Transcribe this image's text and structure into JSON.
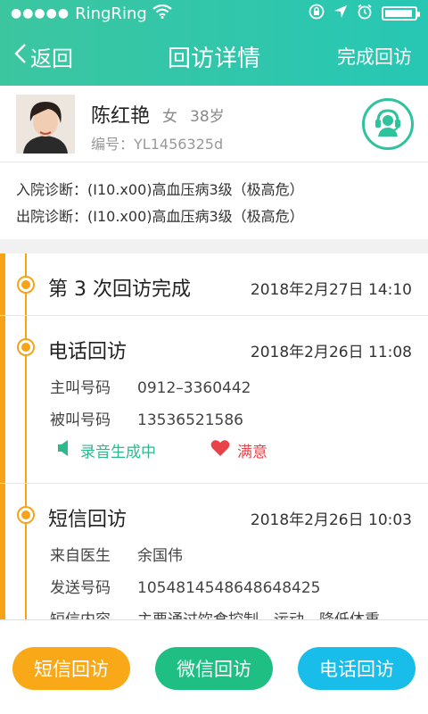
{
  "status_bar": {
    "carrier": "RingRing",
    "signal_dots": "●●●●●"
  },
  "nav": {
    "back_label": "返回",
    "title": "回访详情",
    "action_label": "完成回访"
  },
  "patient": {
    "name": "陈红艳",
    "gender": "女",
    "age": "38岁",
    "id_label": "编号：",
    "id_value": "YL1456325d"
  },
  "diagnosis": {
    "admission_label": "入院诊断：",
    "admission_value": "(I10.x00)高血压病3级（极高危）",
    "discharge_label": "出院诊断：",
    "discharge_value": "(I10.x00)高血压病3级（极高危）"
  },
  "timeline": [
    {
      "title": "第 3 次回访完成",
      "time": "2018年2月27日 14:10"
    },
    {
      "title": "电话回访",
      "time": "2018年2月26日 11:08",
      "fields": [
        {
          "label": "主叫号码",
          "value": "0912–3360442"
        },
        {
          "label": "被叫号码",
          "value": "13536521586"
        }
      ],
      "recording_status": "录音生成中",
      "satisfaction": "满意"
    },
    {
      "title": "短信回访",
      "time": "2018年2月26日 10:03",
      "fields": [
        {
          "label": "来自医生",
          "value": "余国伟"
        },
        {
          "label": "发送号码",
          "value": "1054814548648648425"
        },
        {
          "label": "短信内容",
          "value": "主要通过饮食控制、运动、降低体重"
        }
      ]
    }
  ],
  "actions": {
    "sms_label": "短信回访",
    "wechat_label": "微信回访",
    "phone_label": "电话回访"
  },
  "colors": {
    "header_green": "#2fc3a6",
    "orange": "#f6a31a",
    "sms": "#f9a918",
    "wechat": "#1fbf83",
    "phone": "#18bde9",
    "recording": "#2bb98d",
    "heart": "#e8434a"
  },
  "icons": {
    "back": "chevron-left-icon",
    "call": "customer-service-icon",
    "wifi": "wifi-icon",
    "lock": "rotation-lock-icon",
    "location": "location-arrow-icon",
    "alarm": "alarm-icon",
    "battery": "battery-icon",
    "recording": "speaker-icon",
    "satisfaction": "heart-icon"
  },
  "battery_level": 0.95
}
